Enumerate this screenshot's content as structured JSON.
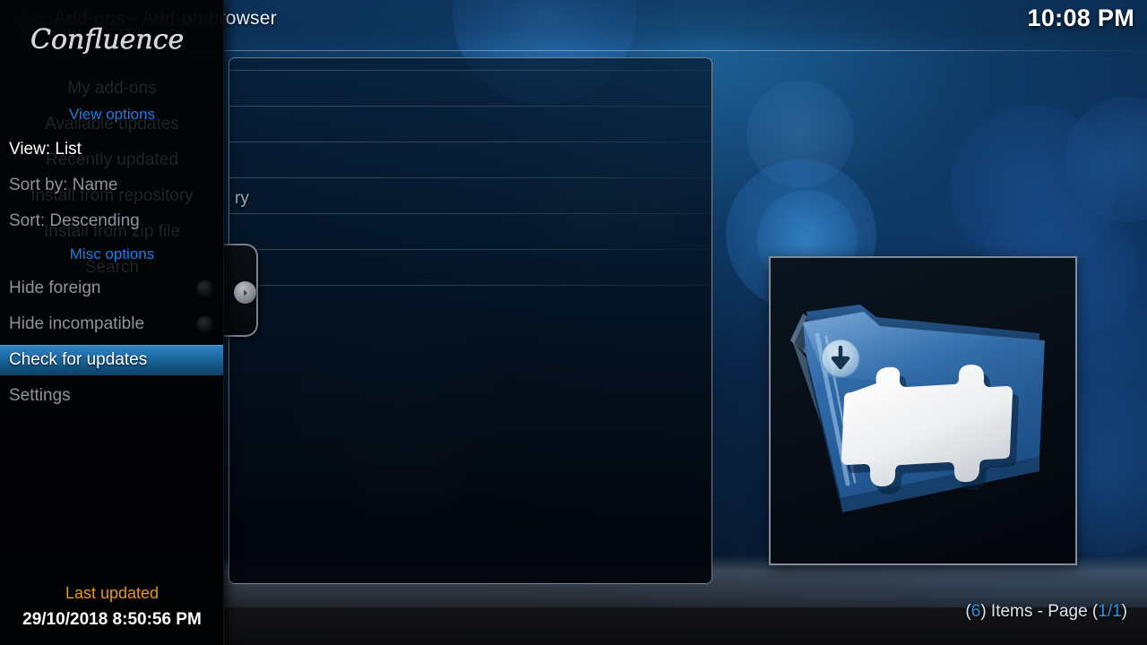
{
  "header": {
    "title": "Add-ons - Add-on browser",
    "clock": "10:08 PM",
    "puzzle_icon": "puzzle-icon"
  },
  "skin": {
    "name": "Confluence"
  },
  "background_menu": {
    "items": [
      {
        "label": "My add-ons"
      },
      {
        "label": "Available updates"
      },
      {
        "label": "Recently updated"
      },
      {
        "label": "Install from repository"
      },
      {
        "label": "Install from zip file"
      },
      {
        "label": "Search"
      }
    ]
  },
  "list_panel": {
    "visible_row_label": "ry",
    "tab_icon": "chevron-right-icon"
  },
  "sidebar": {
    "groups": [
      {
        "label": "View options"
      },
      {
        "label": "Misc options"
      }
    ],
    "options": [
      {
        "label": "View: List",
        "type": "value",
        "state": "focused"
      },
      {
        "label": "Sort by: Name",
        "type": "value",
        "state": "normal"
      },
      {
        "label": "Sort: Descending",
        "type": "value",
        "state": "normal"
      },
      {
        "label": "Hide foreign",
        "type": "toggle",
        "value": "off",
        "state": "normal"
      },
      {
        "label": "Hide incompatible",
        "type": "toggle",
        "value": "off",
        "state": "normal"
      },
      {
        "label": "Check for updates",
        "type": "action",
        "state": "selected"
      },
      {
        "label": "Settings",
        "type": "action",
        "state": "normal"
      }
    ],
    "last_updated_label": "Last updated",
    "last_updated_value": "29/10/2018 8:50:56 PM"
  },
  "footer": {
    "items_open": "(",
    "items_count": "6",
    "items_mid": ") Items - Page (",
    "page_value": "1/1",
    "items_close": ")"
  },
  "addon_icon": {
    "name": "addon-repository-icon",
    "description": "blue binder with white puzzle piece and download badge"
  },
  "colors": {
    "accent_blue": "#1a7fe8",
    "highlight_blue": "#2f86c6",
    "amber": "#e8981f",
    "text_primary": "#ffffff",
    "text_secondary": "#8e949c"
  }
}
